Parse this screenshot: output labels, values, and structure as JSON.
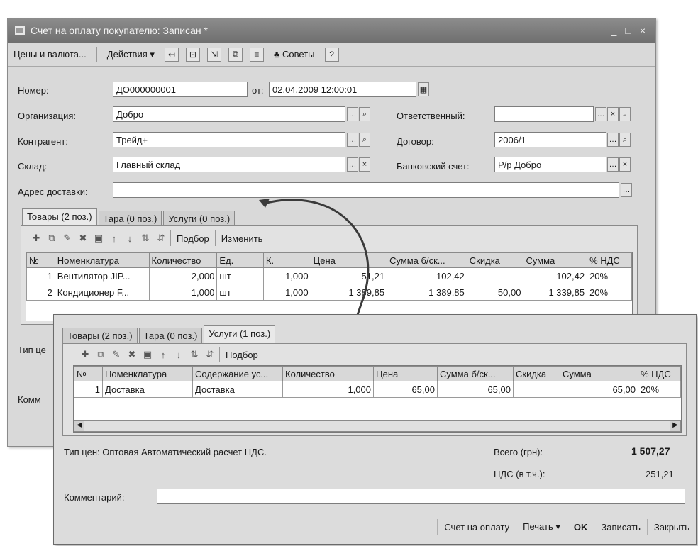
{
  "window1": {
    "title": "Счет на оплату покупателю: Записан *",
    "title_buttons": [
      "_",
      "□",
      "×"
    ],
    "toolbar": {
      "prices": "Цены и валюта...",
      "actions": "Действия ▾",
      "tips": "Советы",
      "help": "?"
    },
    "fields": {
      "number_label": "Номер:",
      "number_value": "ДО000000001",
      "date_label": "от:",
      "date_value": "02.04.2009 12:00:01",
      "org_label": "Организация:",
      "org_value": "Добро",
      "resp_label": "Ответственный:",
      "resp_value": "",
      "contr_label": "Контрагент:",
      "contr_value": "Трейд+",
      "contract_label": "Договор:",
      "contract_value": "2006/1",
      "store_label": "Склад:",
      "store_value": "Главный склад",
      "bank_label": "Банковский счет:",
      "bank_value": "Р/р Добро",
      "addr_label": "Адрес доставки:",
      "addr_value": ""
    },
    "tabs": [
      "Товары (2 поз.)",
      "Тара (0 поз.)",
      "Услуги (0 поз.)"
    ],
    "panel_toolbar": {
      "select": "Подбор",
      "change": "Изменить"
    },
    "grid": {
      "columns": [
        "№",
        "Номенклатура",
        "Количество",
        "Ед.",
        "К.",
        "Цена",
        "Сумма б/ск...",
        "Скидка",
        "Сумма",
        "% НДС"
      ],
      "rows": [
        [
          "1",
          "Вентилятор JIP...",
          "2,000",
          "шт",
          "1,000",
          "51,21",
          "102,42",
          "",
          "102,42",
          "20%"
        ],
        [
          "2",
          "Кондиционер F...",
          "1,000",
          "шт",
          "1,000",
          "1 389,85",
          "1 389,85",
          "50,00",
          "1 339,85",
          "20%"
        ]
      ]
    },
    "price_type_label": "Тип це",
    "comment_label": "Комм"
  },
  "window2": {
    "tabs": [
      "Товары (2 поз.)",
      "Тара (0 поз.)",
      "Услуги (1 поз.)"
    ],
    "panel_toolbar": {
      "select": "Подбор"
    },
    "grid": {
      "columns": [
        "№",
        "Номенклатура",
        "Содержание ус...",
        "Количество",
        "Цена",
        "Сумма б/ск...",
        "Скидка",
        "Сумма",
        "% НДС"
      ],
      "rows": [
        [
          "1",
          "Доставка",
          "Доставка",
          "1,000",
          "65,00",
          "65,00",
          "",
          "65,00",
          "20%"
        ]
      ]
    },
    "price_type": "Тип цен: Оптовая Автоматический расчет НДС.",
    "total_label": "Всего (грн):",
    "total_value": "1 507,27",
    "vat_label": "НДС (в т.ч.):",
    "vat_value": "251,21",
    "comment_label": "Комментарий:",
    "comment_value": "",
    "buttons": {
      "invoice": "Счет на оплату",
      "print": "Печать ▾",
      "ok": "OK",
      "save": "Записать",
      "close": "Закрыть"
    }
  }
}
